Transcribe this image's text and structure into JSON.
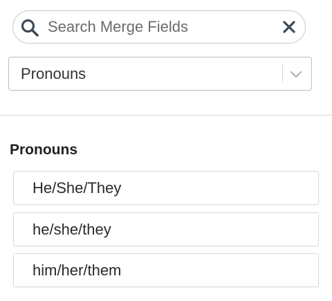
{
  "search": {
    "placeholder": "Search Merge Fields",
    "value": ""
  },
  "category_select": {
    "selected": "Pronouns"
  },
  "section": {
    "title": "Pronouns",
    "items": [
      {
        "label": "He/She/They"
      },
      {
        "label": "he/she/they"
      },
      {
        "label": "him/her/them"
      }
    ]
  },
  "icons": {
    "search": "search-icon",
    "clear": "close-icon",
    "dropdown": "chevron-down-icon"
  },
  "colors": {
    "icon_dark": "#3d4a56",
    "border": "#c9c9c9",
    "chevron": "#b8b8b8"
  }
}
